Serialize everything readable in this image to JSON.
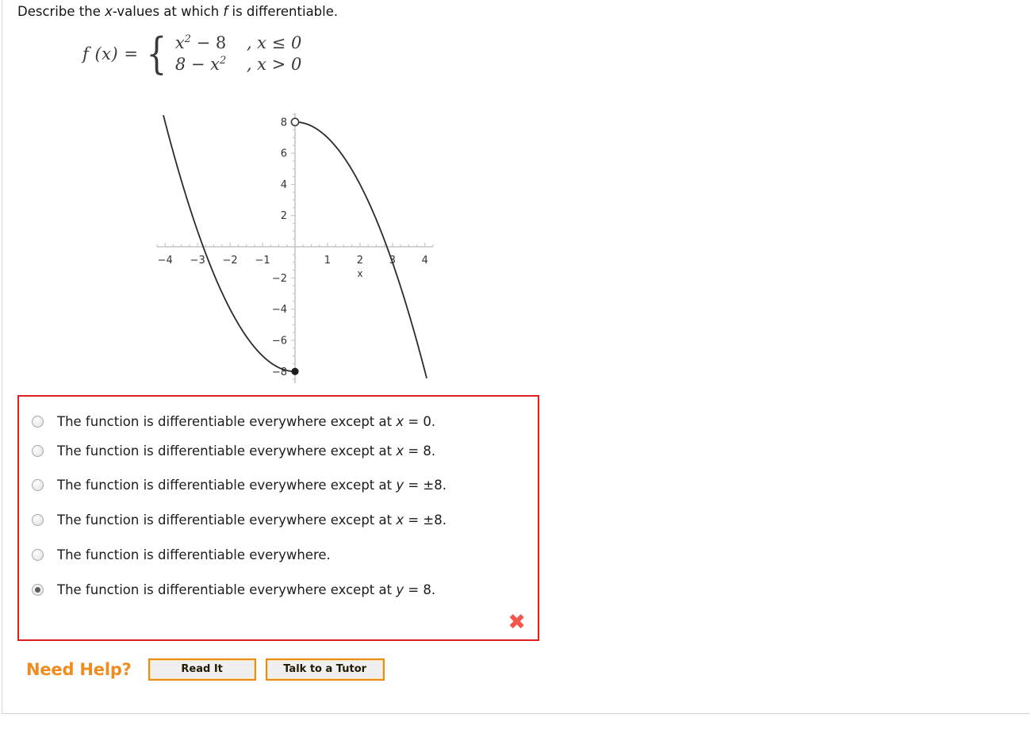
{
  "question": {
    "prefix": "Describe the ",
    "var1": "x",
    "mid": "-values at which ",
    "var2": "f",
    "suffix": " is differentiable."
  },
  "formula": {
    "lhs": "f (x) =",
    "case1_expr_base": "x",
    "case1_expr_sup": "2",
    "case1_expr_rest": " − 8",
    "case1_cond": ", x ≤ 0",
    "case2_expr_base": "8 − x",
    "case2_expr_sup": "2",
    "case2_expr_rest": "",
    "case2_cond": ", x > 0"
  },
  "chart_data": {
    "type": "line",
    "title": "",
    "xlabel": "x",
    "ylabel": "",
    "xlim": [
      -4.2,
      4.2
    ],
    "ylim": [
      -8.8,
      8.6
    ],
    "xticks": [
      -4,
      -3,
      -2,
      -1,
      1,
      2,
      3,
      4
    ],
    "yticks": [
      8,
      6,
      4,
      2,
      -2,
      -4,
      -6,
      -8
    ],
    "xtick_labels": [
      "−4",
      "−3",
      "−2",
      "−1",
      "1",
      "2",
      "3",
      "4"
    ],
    "ytick_labels": [
      "8",
      "6",
      "4",
      "2",
      "−2",
      "−4",
      "−6",
      "−8"
    ],
    "grid": false,
    "legend": "none",
    "axis_color": "#bfbfbf",
    "curve_color": "#2b2b2b",
    "series": [
      {
        "name": "x^2 - 8 for x <= 0",
        "domain": [
          -4.05,
          0
        ],
        "formula": "x*x - 8",
        "endpoint_right": {
          "x": 0,
          "y": -8,
          "marker": "filled"
        }
      },
      {
        "name": "8 - x^2 for x > 0",
        "domain": [
          0,
          4.05
        ],
        "formula": "8 - x*x",
        "endpoint_left": {
          "x": 0,
          "y": 8,
          "marker": "open"
        }
      }
    ],
    "annotations": [
      {
        "text": "open circle at (0, 8)",
        "x": 0,
        "y": 8
      },
      {
        "text": "closed circle at (0, -8)",
        "x": 0,
        "y": -8
      }
    ]
  },
  "answers": {
    "border_color": "#e02020",
    "options": [
      {
        "id": "opt-1",
        "selected": false,
        "pre": "The function is differentiable everywhere except at ",
        "var": "x",
        "post": " = 0."
      },
      {
        "id": "opt-2",
        "selected": false,
        "pre": "The function is differentiable everywhere except at ",
        "var": "x",
        "post": " = 8."
      },
      {
        "id": "opt-3",
        "selected": false,
        "pre": "The function is differentiable everywhere except at ",
        "var": "y",
        "post": " = ±8."
      },
      {
        "id": "opt-4",
        "selected": false,
        "pre": "The function is differentiable everywhere except at ",
        "var": "x",
        "post": " = ±8."
      },
      {
        "id": "opt-5",
        "selected": false,
        "pre": "The function is differentiable everywhere.",
        "var": "",
        "post": ""
      },
      {
        "id": "opt-6",
        "selected": true,
        "pre": "The function is differentiable everywhere except at ",
        "var": "y",
        "post": " = 8."
      }
    ],
    "result_mark": "✖",
    "result_mark_color": "#f4564e"
  },
  "need_help": {
    "label": "Need Help?",
    "read_it": "Read It",
    "talk_to_tutor": "Talk to a Tutor",
    "accent_color": "#f08c1e"
  }
}
